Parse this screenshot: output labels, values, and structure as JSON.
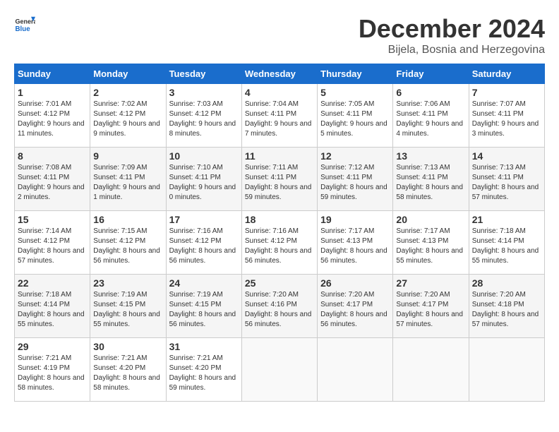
{
  "logo": {
    "general": "General",
    "blue": "Blue"
  },
  "title": "December 2024",
  "location": "Bijela, Bosnia and Herzegovina",
  "weekdays": [
    "Sunday",
    "Monday",
    "Tuesday",
    "Wednesday",
    "Thursday",
    "Friday",
    "Saturday"
  ],
  "weeks": [
    [
      {
        "day": "1",
        "sunrise": "7:01 AM",
        "sunset": "4:12 PM",
        "daylight": "9 hours and 11 minutes."
      },
      {
        "day": "2",
        "sunrise": "7:02 AM",
        "sunset": "4:12 PM",
        "daylight": "9 hours and 9 minutes."
      },
      {
        "day": "3",
        "sunrise": "7:03 AM",
        "sunset": "4:12 PM",
        "daylight": "9 hours and 8 minutes."
      },
      {
        "day": "4",
        "sunrise": "7:04 AM",
        "sunset": "4:11 PM",
        "daylight": "9 hours and 7 minutes."
      },
      {
        "day": "5",
        "sunrise": "7:05 AM",
        "sunset": "4:11 PM",
        "daylight": "9 hours and 5 minutes."
      },
      {
        "day": "6",
        "sunrise": "7:06 AM",
        "sunset": "4:11 PM",
        "daylight": "9 hours and 4 minutes."
      },
      {
        "day": "7",
        "sunrise": "7:07 AM",
        "sunset": "4:11 PM",
        "daylight": "9 hours and 3 minutes."
      }
    ],
    [
      {
        "day": "8",
        "sunrise": "7:08 AM",
        "sunset": "4:11 PM",
        "daylight": "9 hours and 2 minutes."
      },
      {
        "day": "9",
        "sunrise": "7:09 AM",
        "sunset": "4:11 PM",
        "daylight": "9 hours and 1 minute."
      },
      {
        "day": "10",
        "sunrise": "7:10 AM",
        "sunset": "4:11 PM",
        "daylight": "9 hours and 0 minutes."
      },
      {
        "day": "11",
        "sunrise": "7:11 AM",
        "sunset": "4:11 PM",
        "daylight": "8 hours and 59 minutes."
      },
      {
        "day": "12",
        "sunrise": "7:12 AM",
        "sunset": "4:11 PM",
        "daylight": "8 hours and 59 minutes."
      },
      {
        "day": "13",
        "sunrise": "7:13 AM",
        "sunset": "4:11 PM",
        "daylight": "8 hours and 58 minutes."
      },
      {
        "day": "14",
        "sunrise": "7:13 AM",
        "sunset": "4:11 PM",
        "daylight": "8 hours and 57 minutes."
      }
    ],
    [
      {
        "day": "15",
        "sunrise": "7:14 AM",
        "sunset": "4:12 PM",
        "daylight": "8 hours and 57 minutes."
      },
      {
        "day": "16",
        "sunrise": "7:15 AM",
        "sunset": "4:12 PM",
        "daylight": "8 hours and 56 minutes."
      },
      {
        "day": "17",
        "sunrise": "7:16 AM",
        "sunset": "4:12 PM",
        "daylight": "8 hours and 56 minutes."
      },
      {
        "day": "18",
        "sunrise": "7:16 AM",
        "sunset": "4:12 PM",
        "daylight": "8 hours and 56 minutes."
      },
      {
        "day": "19",
        "sunrise": "7:17 AM",
        "sunset": "4:13 PM",
        "daylight": "8 hours and 56 minutes."
      },
      {
        "day": "20",
        "sunrise": "7:17 AM",
        "sunset": "4:13 PM",
        "daylight": "8 hours and 55 minutes."
      },
      {
        "day": "21",
        "sunrise": "7:18 AM",
        "sunset": "4:14 PM",
        "daylight": "8 hours and 55 minutes."
      }
    ],
    [
      {
        "day": "22",
        "sunrise": "7:18 AM",
        "sunset": "4:14 PM",
        "daylight": "8 hours and 55 minutes."
      },
      {
        "day": "23",
        "sunrise": "7:19 AM",
        "sunset": "4:15 PM",
        "daylight": "8 hours and 55 minutes."
      },
      {
        "day": "24",
        "sunrise": "7:19 AM",
        "sunset": "4:15 PM",
        "daylight": "8 hours and 56 minutes."
      },
      {
        "day": "25",
        "sunrise": "7:20 AM",
        "sunset": "4:16 PM",
        "daylight": "8 hours and 56 minutes."
      },
      {
        "day": "26",
        "sunrise": "7:20 AM",
        "sunset": "4:17 PM",
        "daylight": "8 hours and 56 minutes."
      },
      {
        "day": "27",
        "sunrise": "7:20 AM",
        "sunset": "4:17 PM",
        "daylight": "8 hours and 57 minutes."
      },
      {
        "day": "28",
        "sunrise": "7:20 AM",
        "sunset": "4:18 PM",
        "daylight": "8 hours and 57 minutes."
      }
    ],
    [
      {
        "day": "29",
        "sunrise": "7:21 AM",
        "sunset": "4:19 PM",
        "daylight": "8 hours and 58 minutes."
      },
      {
        "day": "30",
        "sunrise": "7:21 AM",
        "sunset": "4:20 PM",
        "daylight": "8 hours and 58 minutes."
      },
      {
        "day": "31",
        "sunrise": "7:21 AM",
        "sunset": "4:20 PM",
        "daylight": "8 hours and 59 minutes."
      },
      null,
      null,
      null,
      null
    ]
  ]
}
